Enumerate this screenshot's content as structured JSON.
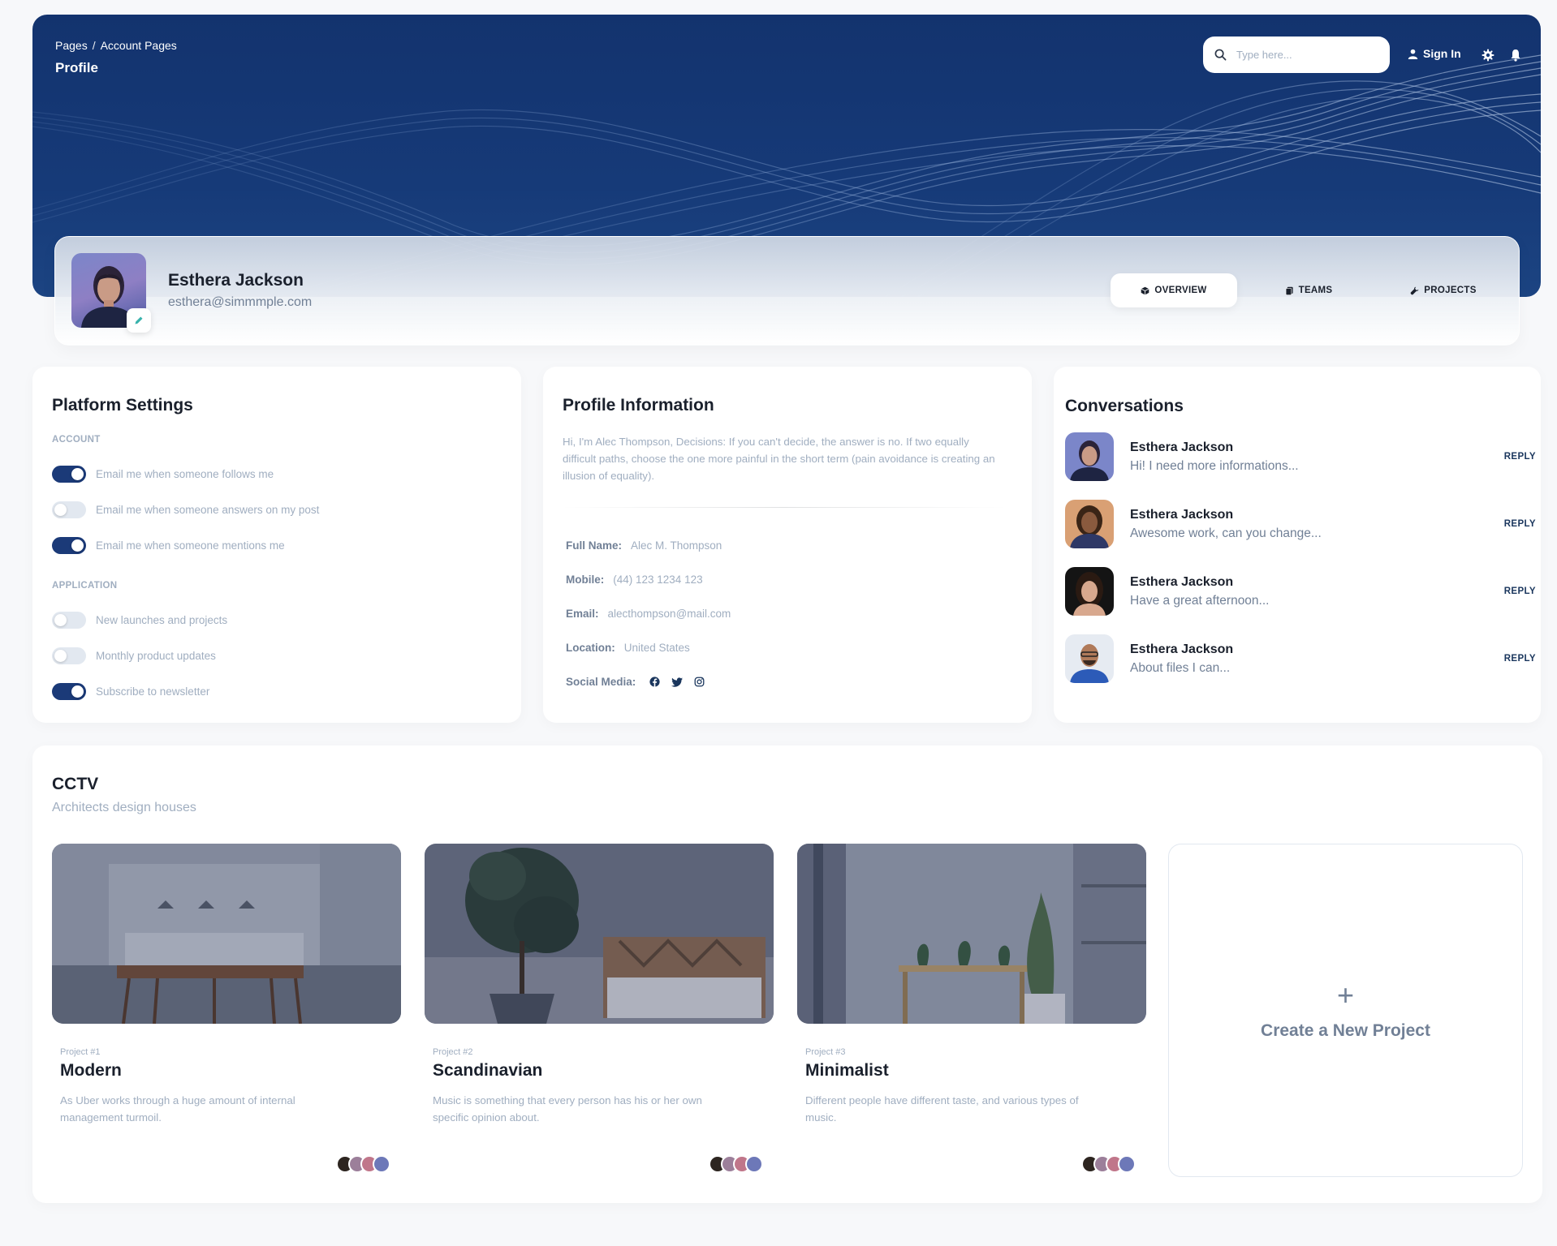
{
  "header": {
    "breadcrumb": [
      "Pages",
      "/",
      "Account Pages"
    ],
    "page_title": "Profile",
    "search_placeholder": "Type here...",
    "sign_in": "Sign In"
  },
  "profile": {
    "name": "Esthera Jackson",
    "email": "esthera@simmmple.com",
    "tabs": [
      {
        "label": "OVERVIEW",
        "icon": "cube-icon",
        "active": true
      },
      {
        "label": "TEAMS",
        "icon": "document-icon",
        "active": false
      },
      {
        "label": "PROJECTS",
        "icon": "wrench-icon",
        "active": false
      }
    ]
  },
  "platform_settings": {
    "title": "Platform Settings",
    "sections": [
      {
        "label": "ACCOUNT",
        "items": [
          {
            "label": "Email me when someone follows me",
            "on": true
          },
          {
            "label": "Email me when someone answers on my post",
            "on": false
          },
          {
            "label": "Email me when someone mentions me",
            "on": true
          }
        ]
      },
      {
        "label": "APPLICATION",
        "items": [
          {
            "label": "New launches and projects",
            "on": false
          },
          {
            "label": "Monthly product updates",
            "on": false
          },
          {
            "label": "Subscribe to newsletter",
            "on": true
          }
        ]
      }
    ]
  },
  "profile_info": {
    "title": "Profile Information",
    "description": "Hi, I'm Alec Thompson, Decisions: If you can't decide, the answer is no. If two equally difficult paths, choose the one more painful in the short term (pain avoidance is creating an illusion of equality).",
    "fields": [
      {
        "key": "Full Name:",
        "value": "Alec M. Thompson"
      },
      {
        "key": "Mobile:",
        "value": "(44) 123 1234 123"
      },
      {
        "key": "Email:",
        "value": "alecthompson@mail.com"
      },
      {
        "key": "Location:",
        "value": "United States"
      }
    ],
    "social_label": "Social Media:",
    "social_icons": [
      "facebook-icon",
      "twitter-icon",
      "instagram-icon"
    ]
  },
  "conversations": {
    "title": "Conversations",
    "items": [
      {
        "name": "Esthera Jackson",
        "message": "Hi! I need more informations...",
        "reply": "REPLY"
      },
      {
        "name": "Esthera Jackson",
        "message": "Awesome work, can you change...",
        "reply": "REPLY"
      },
      {
        "name": "Esthera Jackson",
        "message": "Have a great afternoon...",
        "reply": "REPLY"
      },
      {
        "name": "Esthera Jackson",
        "message": "About files I can...",
        "reply": "REPLY"
      }
    ]
  },
  "projects": {
    "title": "CCTV",
    "subtitle": "Architects design houses",
    "items": [
      {
        "number": "Project #1",
        "name": "Modern",
        "description": "As Uber works through a huge amount of internal management turmoil."
      },
      {
        "number": "Project #2",
        "name": "Scandinavian",
        "description": "Music is something that every person has his or her own specific opinion about."
      },
      {
        "number": "Project #3",
        "name": "Minimalist",
        "description": "Different people have different taste, and various types of music."
      }
    ],
    "new_project_label": "Create a New Project",
    "new_project_icon": "+"
  },
  "colors": {
    "brand_navy": "#1b3a78",
    "hero_bg": "#13336e",
    "text_dark": "#1a202c",
    "text_muted": "#a0aec0"
  }
}
